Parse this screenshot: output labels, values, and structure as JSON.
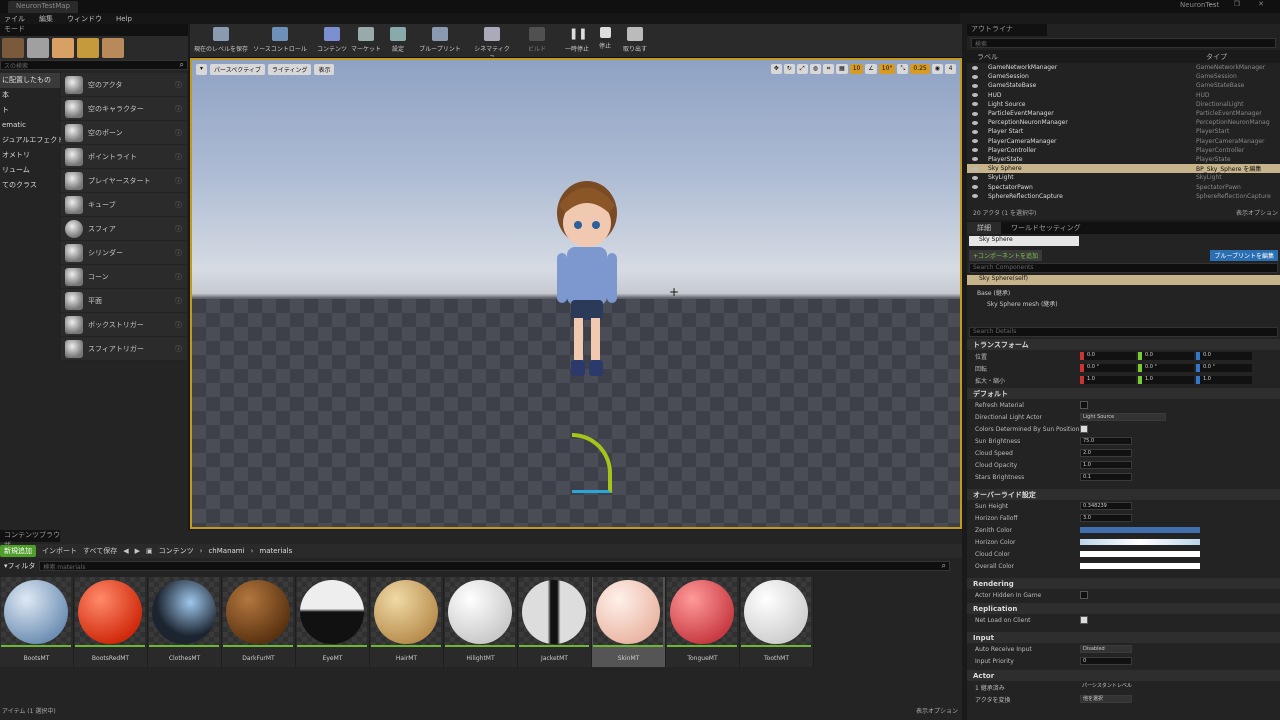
{
  "titlebar": {
    "tab": "NeuronTestMap",
    "project": "NeuronTest",
    "window_controls": "— ❐ ✕"
  },
  "menu": [
    "ァイル",
    "編集",
    "ウィンドウ",
    "Help"
  ],
  "modes": {
    "tab": "モード",
    "search_placeholder": "スの検索",
    "categories": [
      "に配置したもの",
      "本",
      "ト",
      "ematic",
      "ジュアルエフェクト",
      "オメトリ",
      "リューム",
      "てのクラス"
    ],
    "items": [
      "空のアクタ",
      "空のキャラクター",
      "空のポーン",
      "ポイントライト",
      "プレイヤースタート",
      "キューブ",
      "スフィア",
      "シリンダー",
      "コーン",
      "平面",
      "ボックストリガー",
      "スフィアトリガー"
    ]
  },
  "toolbar": [
    "現在のレベルを保存",
    "ソースコントロール",
    "コンテンツ",
    "マーケット",
    "設定",
    "ブループリント",
    "シネマティクス",
    "ビルド",
    "一時停止",
    "停止",
    "取り出す"
  ],
  "viewport": {
    "perspective": "パースペクティブ",
    "lighting": "ライティング",
    "show": "表示",
    "grid": "10",
    "angle": "10°",
    "scale": "0.25",
    "cam": "4"
  },
  "content_browser": {
    "tab": "コンテンツブラウザ",
    "add_new": "新規追加",
    "import": "インポート",
    "save_all": "すべて保存",
    "path": [
      "コンテンツ",
      "chManami",
      "materials"
    ],
    "filter": "フィルタ",
    "search_placeholder": "検索 materials",
    "assets": [
      "BootsMT",
      "BootsRedMT",
      "ClothesMT",
      "DarkFurMT",
      "EyeMT",
      "HairMT",
      "HilightMT",
      "JacketMT",
      "SkinMT",
      "TongueMT",
      "ToothMT"
    ],
    "status": "アイテム (1 選択中)",
    "view_options": "表示オプション"
  },
  "outliner": {
    "tab": "アウトライナ",
    "search_placeholder": "検索",
    "col_label": "ラベル",
    "col_type": "タイプ",
    "rows": [
      {
        "label": "GameNetworkManager",
        "type": "GameNetworkManager"
      },
      {
        "label": "GameSession",
        "type": "GameSession"
      },
      {
        "label": "GameStateBase",
        "type": "GameStateBase"
      },
      {
        "label": "HUD",
        "type": "HUD"
      },
      {
        "label": "Light Source",
        "type": "DirectionalLight"
      },
      {
        "label": "ParticleEventManager",
        "type": "ParticleEventManager"
      },
      {
        "label": "PerceptionNeuronManager",
        "type": "PerceptionNeuronManag"
      },
      {
        "label": "Player Start",
        "type": "PlayerStart"
      },
      {
        "label": "PlayerCameraManager",
        "type": "PlayerCameraManager"
      },
      {
        "label": "PlayerController",
        "type": "PlayerController"
      },
      {
        "label": "PlayerState",
        "type": "PlayerState"
      },
      {
        "label": "Sky Sphere",
        "type": "BP_Sky_Sphere を編集"
      },
      {
        "label": "SkyLight",
        "type": "SkyLight"
      },
      {
        "label": "SpectatorPawn",
        "type": "SpectatorPawn"
      },
      {
        "label": "SphereReflectionCapture",
        "type": "SphereReflectionCapture"
      }
    ],
    "status": "20 アクタ (1 を選択中)",
    "view_options": "表示オプション"
  },
  "details": {
    "tab_details": "詳細",
    "tab_world": "ワールドセッティング",
    "actor_name": "Sky Sphere",
    "add_component": "+コンポーネントを追加",
    "edit_blueprint": "ブループリントを編集",
    "search_components": "Search Components",
    "self": "Sky Sphere(self)",
    "base": "Base (継承)",
    "mesh": "Sky Sphere mesh (継承)",
    "search_details": "Search Details",
    "transform": "トランスフォーム",
    "location": "位置",
    "rotation": "回転",
    "scale": "拡大・縮小",
    "loc_vals": [
      "0.0",
      "0.0",
      "0.0"
    ],
    "rot_vals": [
      "0.0 °",
      "0.0 °",
      "0.0 °"
    ],
    "scale_vals": [
      "1.0",
      "1.0",
      "1.0"
    ],
    "default": "デフォルト",
    "refresh_material": "Refresh Material",
    "dir_light_actor": "Directional Light Actor",
    "dir_light_val": "Light Source",
    "colors_by_sun": "Colors Determined By Sun Position",
    "sun_brightness": "Sun Brightness",
    "sun_brightness_val": "75.0",
    "cloud_speed": "Cloud Speed",
    "cloud_speed_val": "2.0",
    "cloud_opacity": "Cloud Opacity",
    "cloud_opacity_val": "1.0",
    "stars_brightness": "Stars Brightness",
    "stars_brightness_val": "0.1",
    "override": "オーバーライド設定",
    "sun_height": "Sun Height",
    "sun_height_val": "0.348239",
    "horizon_falloff": "Horizon Falloff",
    "horizon_falloff_val": "3.0",
    "zenith_color": "Zenith Color",
    "horizon_color": "Horizon Color",
    "cloud_color": "Cloud Color",
    "overall_color": "Overall Color",
    "rendering": "Rendering",
    "hidden_in_game": "Actor Hidden In Game",
    "replication": "Replication",
    "net_load": "Net Load on Client",
    "input": "Input",
    "auto_receive": "Auto Receive Input",
    "auto_receive_val": "Disabled",
    "input_priority": "Input Priority",
    "input_priority_val": "0",
    "actor": "Actor",
    "selected_count": "1 継承済み",
    "level": "パーシスタントレベル",
    "convert_actor": "アクタを変換",
    "convert_val": "他を選択"
  },
  "colors": {
    "accent": "#c39a1c",
    "green": "#4f9d2a",
    "blue_btn": "#2b6fb3",
    "zenith": "#3f6fae"
  }
}
